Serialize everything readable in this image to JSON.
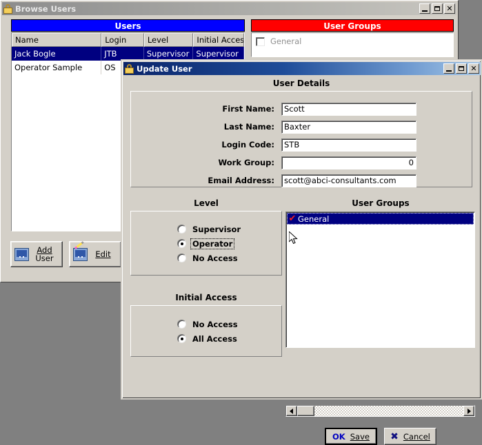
{
  "browse_window": {
    "title": "Browse Users",
    "icon": "lock-icon",
    "minimize": "_",
    "maximize": "□",
    "close": "✕",
    "users_panel": {
      "header": "Users",
      "header_color": "#0000ff",
      "columns": [
        "Name",
        "Login",
        "Level",
        "Initial Access"
      ],
      "rows": [
        {
          "name": "Jack Bogle",
          "login": "JTB",
          "level": "Supervisor",
          "initial_access": "Supervisor",
          "selected": true
        },
        {
          "name": "Operator Sample",
          "login": "OS",
          "level": "",
          "initial_access": "",
          "selected": false
        }
      ]
    },
    "buttons": {
      "add_user_line1": "Add",
      "add_user_line2": "User",
      "edit": "Edit"
    },
    "user_groups_panel": {
      "header": "User Groups",
      "header_color": "#ff0000",
      "items": [
        {
          "label": "General",
          "checked": false
        }
      ]
    }
  },
  "update_dialog": {
    "title": "Update User",
    "icon": "lock-icon",
    "minimize": "_",
    "maximize": "□",
    "close": "✕",
    "section_title": "User Details",
    "fields": [
      {
        "label": "First Name:",
        "value": "Scott",
        "align": "left"
      },
      {
        "label": "Last Name:",
        "value": "Baxter",
        "align": "left"
      },
      {
        "label": "Login Code:",
        "value": "STB",
        "align": "left"
      },
      {
        "label": "Work Group:",
        "value": "0",
        "align": "right"
      },
      {
        "label": "Email Address:",
        "value": "scott@abci-consultants.com",
        "align": "left"
      }
    ],
    "level": {
      "title": "Level",
      "options": [
        {
          "label": "Supervisor",
          "selected": false,
          "focused": false
        },
        {
          "label": "Operator",
          "selected": true,
          "focused": true
        },
        {
          "label": "No Access",
          "selected": false,
          "focused": false
        }
      ]
    },
    "initial_access": {
      "title": "Initial Access",
      "options": [
        {
          "label": "No Access",
          "selected": false,
          "focused": false
        },
        {
          "label": "All Access",
          "selected": true,
          "focused": false
        }
      ]
    },
    "user_groups": {
      "title": "User Groups",
      "items": [
        {
          "label": "General",
          "checked": true,
          "check_mark": "✔",
          "check_color": "#ee2020",
          "selected": true
        }
      ]
    },
    "buttons": {
      "save": {
        "icon_text": "OK",
        "label": "Save",
        "accel": "S"
      },
      "cancel": {
        "icon_text": "✖",
        "label": "Cancel",
        "accel": "C"
      }
    }
  }
}
